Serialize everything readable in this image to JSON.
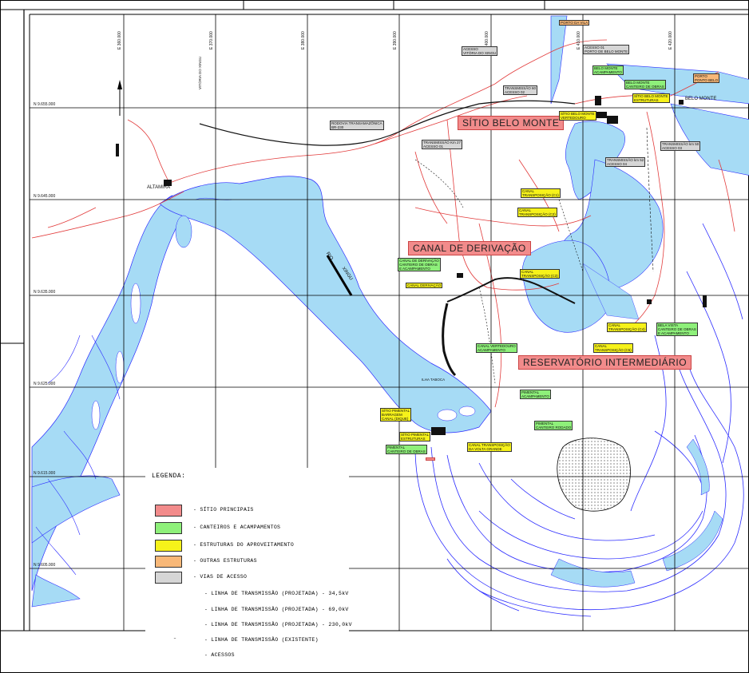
{
  "map": {
    "sites": {
      "belo_monte": "SÍTIO BELO MONTE",
      "canal_derivacao": "CANAL DE DERIVAÇÃO",
      "reservatorio": "RESERVATÓRIO INTERMEDIÁRIO",
      "pimentel": "SÍTIO  PIMENTAL"
    },
    "places": {
      "altamira": "ALTAMIRA",
      "belo_monte_town": "BELO MONTE",
      "rio_xingu_1": "RIO",
      "rio_xingu_2": "XINGU",
      "ilha_taboca": "ILHA TABOCA",
      "vitoria_do_xingu": "VITÓRIA DO XINGU"
    },
    "northings": [
      "N 9.655.000",
      "N 9.645.000",
      "N 9.635.000",
      "N 9.625.000",
      "N 9.615.000",
      "N 9.605.000"
    ],
    "eastings": [
      "E 360.000",
      "E 370.000",
      "E 380.000",
      "E 390.000",
      "E 400.000",
      "E 410.000",
      "E 420.000"
    ],
    "small_labels": {
      "porto_vitoria": "PORTO DA VILA",
      "acesso_vitoria": "ACESSO\nVITÓRIA DO XINGU",
      "acesso_porto": "ACESSO 01\nPORTO DE BELO MONTE",
      "belo_monte_acamp": "BELO MONTE\nACAMPAMENTO",
      "transmissao_acesso": "TRANSMISSÃO 60\nACESSO 02",
      "belo_monte_canteiro": "BELO MONTE\nCANTEIRO DE OBRAS",
      "sitio_bm_estruturas": "SÍTIO BELO MONTE\nESTRUTURAS",
      "porto_pm": "PORTO\nPONTO BELO",
      "sitio_bm_vertedouro": "SÍTIO BELO MONTE\nVERTEDOURO",
      "rodovia_transamazonica": "RODOVIA TRANSAMAZÔNICA\nBR-230",
      "transmissao_km27": "TRANSMISSÃO Km 27\nACESSO 01",
      "transmissao_acesso03": "TRANSMISSÃO km 50\nACESSO 03",
      "transmissao_acesso04": "TRANSMISSÃO km 52\nACESSO 04",
      "canal_transp_c1": "CANAL\nTRANSPOSIÇÃO (C1)",
      "canal_transp_c2": "CANAL\nTRANSPOSIÇÃO (C2)",
      "canal_derivacao_canteiro": "CANAL DE DERIVAÇÃO\nCANTEIRO DE OBRAS\nE ACAMPAMENTO",
      "canal_derivacao_small": "CANAL DERIVAÇÃO",
      "canal_transp_c3": "CANAL\nTRANSPOSIÇÃO (C3)",
      "canal_transp_c4": "CANAL\nTRANSPOSIÇÃO (C4)",
      "canal_transp_c5": "CANAL\nTRANSPOSIÇÃO (C5)",
      "belo_monte_right": "BELA VISTA\nCANTEIRO DE OBRAS\nE ACAMPAMENTO",
      "sitio_pimental_small": "SÍTIO PIMENTAL\nESTRUTURAS",
      "pimental_acamp": "PIMENTAL\nACAMPAMENTO",
      "sitio_pimental_barragem": "SÍTIO PIMENTAL\nBARRAGEM\nCANAL (DIQUE)",
      "sitio_pimental_estr": "SÍTIO PIMENTAL\nESTRUTURAS",
      "pimental_canteiro2": "PIMENTAL\nCANTEIRO RODADO",
      "pimental_canteiro": "PIMENTAL\nCANTEIRO DE OBRAS",
      "canal_transp_small": "CANAL TRANSPOSIÇÃO\nDA VOLTA GRANDE",
      "canal_vertedouro": "CANAL VERTEDOURO\nACAMPAMENTO"
    }
  },
  "legend": {
    "title": "LEGENDA:",
    "items": [
      {
        "label": "- SÍTIO PRINCIPAIS",
        "color": "#f28b8b"
      },
      {
        "label": "- CANTEIROS E ACAMPAMENTOS",
        "color": "#8ef07a"
      },
      {
        "label": "- ESTRUTURAS DO APROVEITAMENTO",
        "color": "#f6f21a"
      },
      {
        "label": "- OUTRAS ESTRUTURAS",
        "color": "#f8b878"
      },
      {
        "label": "- VIAS DE ACESSO",
        "color": "#d6d6d6"
      }
    ],
    "lines": [
      {
        "label": "- LINHA DE TRANSMISSÃO (PROJETADA) - 34,5kV",
        "color": "#111111",
        "style": "dashdot-heavy"
      },
      {
        "label": "- LINHA DE TRANSMISSÃO (PROJETADA) - 69,0kV",
        "color": "#111111",
        "style": "longdash"
      },
      {
        "label": "- LINHA DE TRANSMISSÃO (PROJETADA) - 230,0kV",
        "color": "#111111",
        "style": "dotted"
      },
      {
        "label": "- LINHA DE TRANSMISSÃO (EXISTENTE)",
        "color": "#111111",
        "style": "dotline"
      },
      {
        "label": "- ACESSOS",
        "color": "#e23b3b",
        "style": "solid"
      }
    ]
  },
  "colors": {
    "water": "#a6dbf5",
    "water_outline": "#2b2bff",
    "roads": "#e23b3b",
    "grid": "#000000"
  }
}
